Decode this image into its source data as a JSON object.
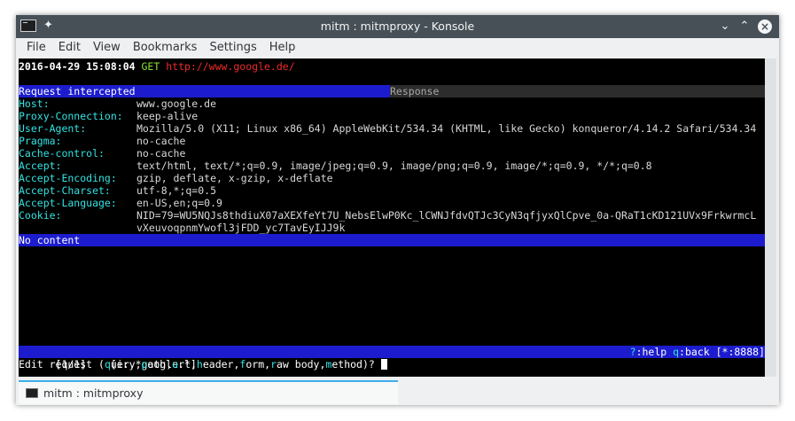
{
  "window": {
    "title": "mitm : mitmproxy - Konsole",
    "icons": {
      "app": "terminal-icon",
      "pin": "pin-icon",
      "minimize": "chevron-down-icon",
      "maximize": "chevron-up-icon",
      "close": "close-icon"
    }
  },
  "menu": [
    "File",
    "Edit",
    "View",
    "Bookmarks",
    "Settings",
    "Help"
  ],
  "terminal": {
    "timestamp": "2016-04-29 15:08:04",
    "method": "GET",
    "url": "http://www.google.de/",
    "tab_request": "Request intercepted",
    "tab_response": "Response",
    "headers": [
      {
        "name": "Host:",
        "value": "www.google.de"
      },
      {
        "name": "Proxy-Connection:",
        "value": "keep-alive"
      },
      {
        "name": "User-Agent:",
        "value": "Mozilla/5.0 (X11; Linux x86_64) AppleWebKit/534.34 (KHTML, like Gecko) konqueror/4.14.2 Safari/534.34"
      },
      {
        "name": "Pragma:",
        "value": "no-cache"
      },
      {
        "name": "Cache-control:",
        "value": "no-cache"
      },
      {
        "name": "Accept:",
        "value": "text/html, text/*;q=0.9, image/jpeg;q=0.9, image/png;q=0.9, image/*;q=0.9, */*;q=0.8"
      },
      {
        "name": "Accept-Encoding:",
        "value": "gzip, deflate, x-gzip, x-deflate"
      },
      {
        "name": "Accept-Charset:",
        "value": "utf-8,*;q=0.5"
      },
      {
        "name": "Accept-Language:",
        "value": "en-US,en;q=0.9"
      },
      {
        "name": "Cookie:",
        "value": "NID=79=WU5NQJs8thdiuX07aXEXfeYt7U_NebsElwP0Kc_lCWNJfdvQTJc3CyN3qfjyxQlCpve_0a-QRaT1cKD121UVx9FrkwrmcL"
      }
    ],
    "cookie_continuation": "vXeuvoqpnmYwofl3jFDD_yc7TavEyIJJ9k",
    "no_content": "No content",
    "status": {
      "position": "[1/1]",
      "filter": "[i:.*google.*]",
      "help_key": "?",
      "help_label": ":help ",
      "back_key": "q",
      "back_label": ":back",
      "port": "[*:8888]"
    },
    "prompt": {
      "prefix": "Edit request (",
      "opt1_key": "q",
      "opt1_rest": "uery",
      "opt2_key": "p",
      "opt2_rest": "ath",
      "opt3_key": "u",
      "opt3_rest": "rl",
      "opt4_key": "h",
      "opt4_rest": "eader",
      "opt5_key": "f",
      "opt5_rest": "orm",
      "opt6_key": "r",
      "opt6_rest": "aw body",
      "opt7_key": "m",
      "opt7_rest": "ethod",
      "suffix": ")? "
    }
  },
  "tabs": [
    {
      "label": "mitm : mitmproxy",
      "icon": "terminal-icon"
    }
  ]
}
